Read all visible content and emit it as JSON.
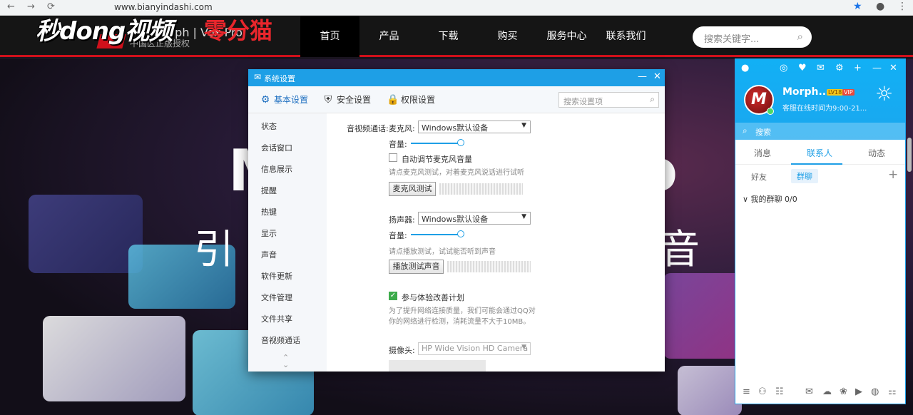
{
  "browser": {
    "url": "www.bianyindashi.com",
    "back": "←",
    "forward": "→",
    "reload": "⟳",
    "star": "★",
    "profile": "●",
    "menu": "⋮"
  },
  "watermark": {
    "left": "秒dong视频",
    "right": "零分猫"
  },
  "site": {
    "product": "Morph | Vox Pro",
    "sub": "中国区正版授权",
    "nav": [
      "首页",
      "产品",
      "下载",
      "购买",
      "服务中心",
      "联系我们"
    ],
    "search_placeholder": "搜索关键字...",
    "search_icon": "⌕"
  },
  "hero": {
    "big_left": "M",
    "big_right": "o",
    "sub_left": "引",
    "sub_right": "音"
  },
  "dialog": {
    "title": "系统设置",
    "title_icon": "✉",
    "min": "—",
    "close": "✕",
    "tabs": [
      {
        "label": "基本设置",
        "icon": "⚙"
      },
      {
        "label": "安全设置",
        "icon": "⛨"
      },
      {
        "label": "权限设置",
        "icon": "🔒"
      }
    ],
    "search_placeholder": "搜索设置项",
    "search_icon": "⌕",
    "sidebar": [
      "状态",
      "会话窗口",
      "信息展示",
      "提醒",
      "热键",
      "显示",
      "声音",
      "软件更新",
      "文件管理",
      "文件共享",
      "音视频通话"
    ],
    "scroll_up": "⌃",
    "scroll_down": "⌄",
    "av": {
      "section": "音视频通话:",
      "mic_label": "麦克风:",
      "mic_device": "Windows默认设备",
      "volume_label": "音量:",
      "mic_auto": "自动调节麦克风音量",
      "mic_hint": "请点麦克风测试，对着麦克风说话进行试听",
      "mic_test": "麦克风测试",
      "spk_label": "扬声器:",
      "spk_device": "Windows默认设备",
      "spk_volume_label": "音量:",
      "spk_hint": "请点播放测试，试试能否听到声音",
      "spk_test": "播放测试声音",
      "improve": "参与体验改善计划",
      "improve_hint1": "为了提升网络连接质量，我们可能会通过QQ对",
      "improve_hint2": "你的网络进行检测，消耗流量不大于10MB。",
      "cam_label": "摄像头:",
      "cam_device": "HP Wide Vision HD Camera",
      "arrow": "▼",
      "check": "✓"
    }
  },
  "qq": {
    "top_icons": [
      "●",
      "◎",
      "♥",
      "✉",
      "⚙",
      "+",
      "—",
      "✕"
    ],
    "avatar_letter": "M",
    "nick": "Morph...",
    "badge1": "LV18",
    "badge2": "VIP",
    "sign": "客服在线时间为9:00-21...",
    "weather": "☼",
    "search_placeholder": "搜索",
    "search_icon": "⌕",
    "tabs": [
      "消息",
      "联系人",
      "动态"
    ],
    "sub_tabs": [
      "好友",
      "群聊"
    ],
    "add": "+",
    "group": "∨  我的群聊 0/0",
    "bottom_icons": [
      "≡",
      "⚇",
      "☷",
      "✉",
      "☁",
      "❀",
      "▶",
      "◍",
      "⚏"
    ]
  }
}
